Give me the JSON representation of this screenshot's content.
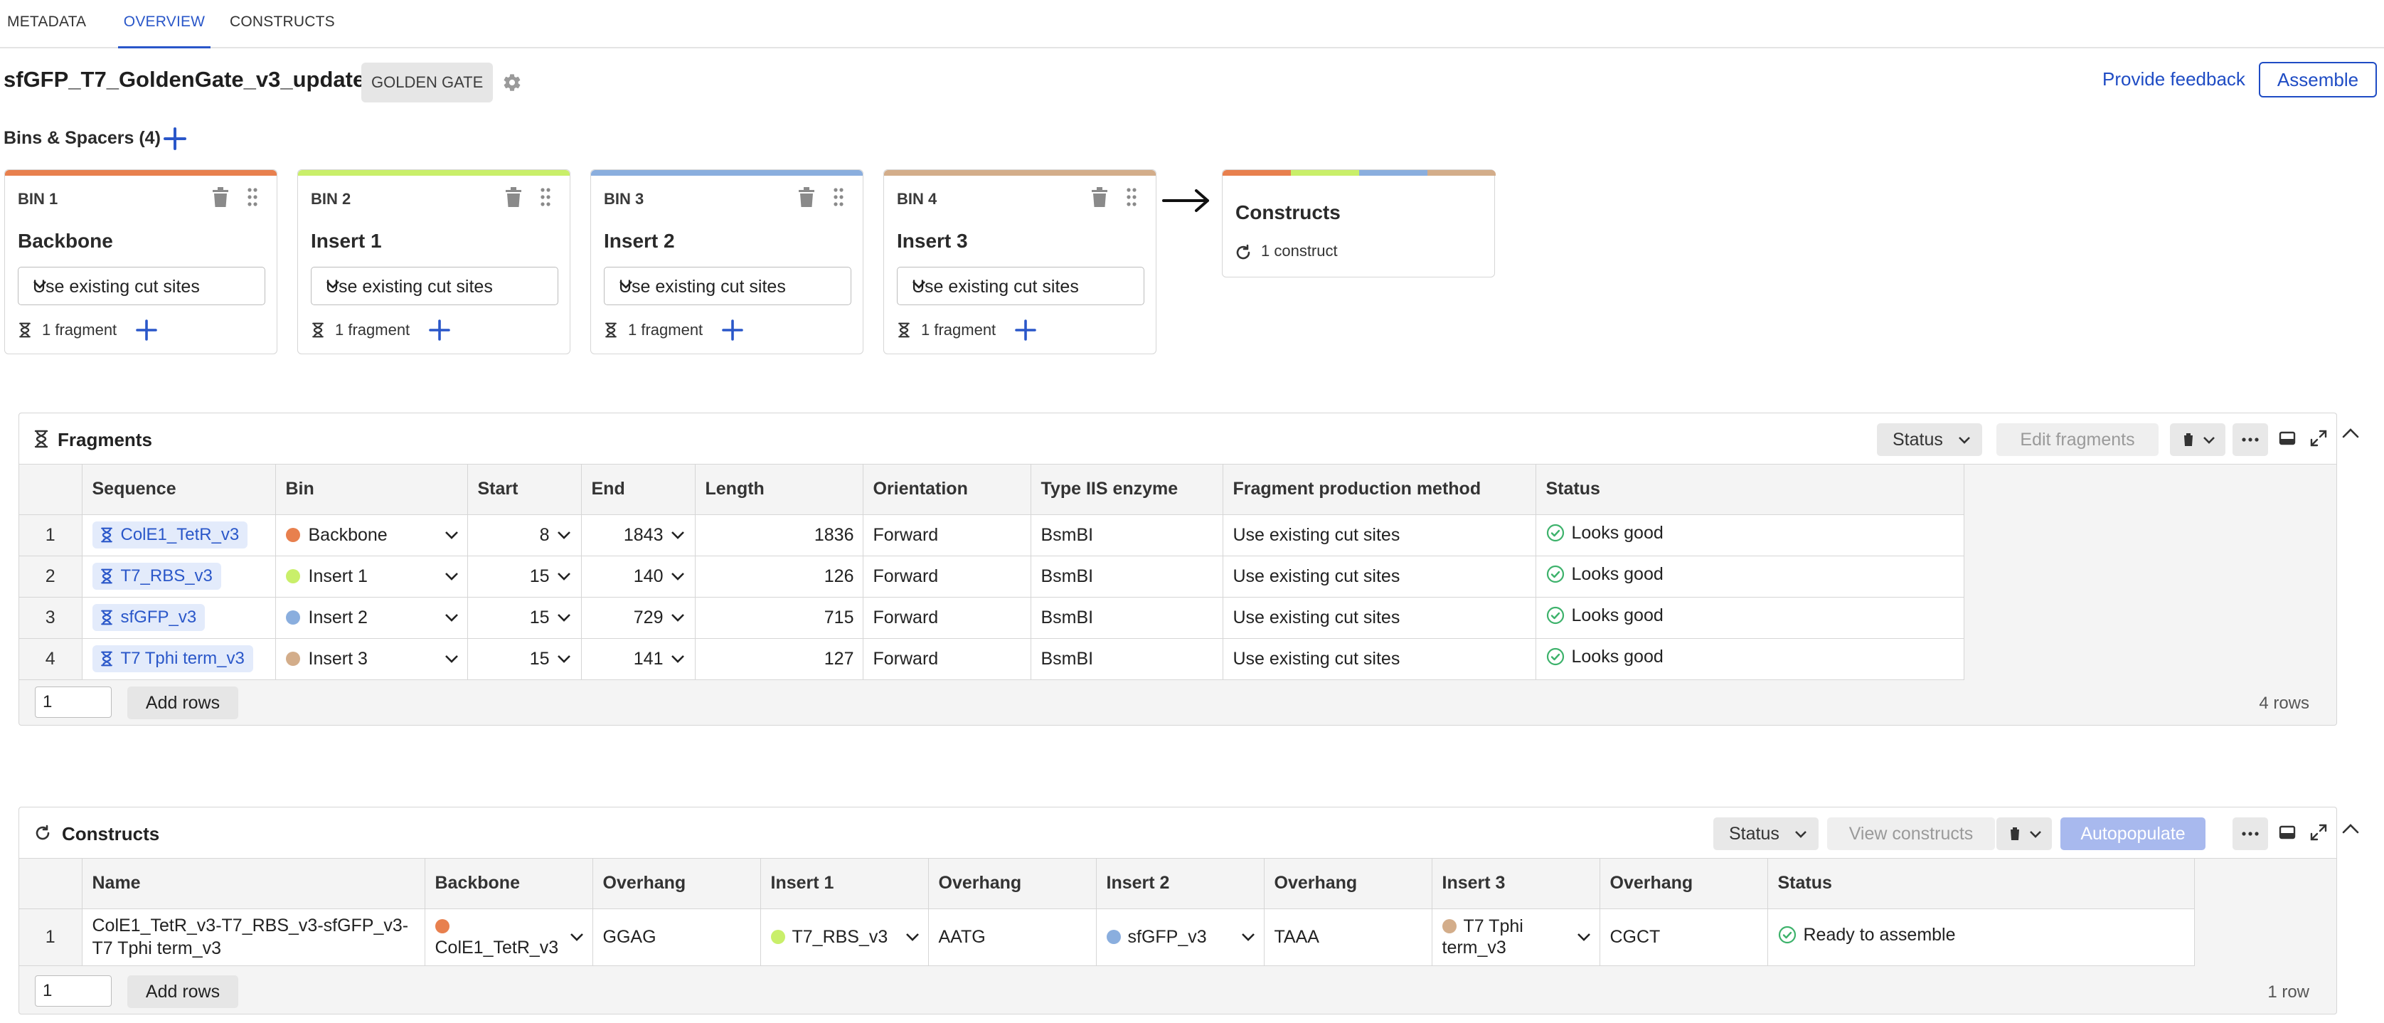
{
  "tabs": [
    {
      "label": "METADATA"
    },
    {
      "label": "OVERVIEW",
      "active": true
    },
    {
      "label": "CONSTRUCTS"
    }
  ],
  "header": {
    "title": "sfGFP_T7_GoldenGate_v3_updated",
    "badge": "GOLDEN GATE",
    "feedback_label": "Provide feedback",
    "assemble_label": "Assemble"
  },
  "bins_section": {
    "label": "Bins & Spacers (4)"
  },
  "colors": {
    "accent": "#2a57c9",
    "bin1": "#e8804e",
    "bin2": "#c9ef6a",
    "bin3": "#8aaede",
    "bin4": "#d3ad8a",
    "ok": "#3db26b"
  },
  "bins": [
    {
      "id": "BIN 1",
      "name": "Backbone",
      "method": "Use existing cut sites",
      "fragments": "1 fragment",
      "color": "#e8804e"
    },
    {
      "id": "BIN 2",
      "name": "Insert 1",
      "method": "Use existing cut sites",
      "fragments": "1 fragment",
      "color": "#c9ef6a"
    },
    {
      "id": "BIN 3",
      "name": "Insert 2",
      "method": "Use existing cut sites",
      "fragments": "1 fragment",
      "color": "#8aaede"
    },
    {
      "id": "BIN 4",
      "name": "Insert 3",
      "method": "Use existing cut sites",
      "fragments": "1 fragment",
      "color": "#d3ad8a"
    }
  ],
  "constructs_card": {
    "title": "Constructs",
    "count": "1 construct"
  },
  "fragments_panel": {
    "title": "Fragments",
    "status_btn": "Status",
    "edit_btn": "Edit fragments",
    "columns": [
      "",
      "Sequence",
      "Bin",
      "Start",
      "End",
      "Length",
      "Orientation",
      "Type IIS enzyme",
      "Fragment production method",
      "Status"
    ],
    "rows": [
      {
        "n": "1",
        "sequence": "ColE1_TetR_v3",
        "bin": "Backbone",
        "bin_color": "#e8804e",
        "start": "8",
        "end": "1843",
        "length": "1836",
        "orientation": "Forward",
        "enzyme": "BsmBI",
        "method": "Use existing cut sites",
        "status": "Looks good"
      },
      {
        "n": "2",
        "sequence": "T7_RBS_v3",
        "bin": "Insert 1",
        "bin_color": "#c9ef6a",
        "start": "15",
        "end": "140",
        "length": "126",
        "orientation": "Forward",
        "enzyme": "BsmBI",
        "method": "Use existing cut sites",
        "status": "Looks good"
      },
      {
        "n": "3",
        "sequence": "sfGFP_v3",
        "bin": "Insert 2",
        "bin_color": "#8aaede",
        "start": "15",
        "end": "729",
        "length": "715",
        "orientation": "Forward",
        "enzyme": "BsmBI",
        "method": "Use existing cut sites",
        "status": "Looks good"
      },
      {
        "n": "4",
        "sequence": "T7 Tphi term_v3",
        "bin": "Insert 3",
        "bin_color": "#d3ad8a",
        "start": "15",
        "end": "141",
        "length": "127",
        "orientation": "Forward",
        "enzyme": "BsmBI",
        "method": "Use existing cut sites",
        "status": "Looks good"
      }
    ],
    "rows_input": "1",
    "add_rows": "Add rows",
    "row_count": "4 rows"
  },
  "constructs_panel": {
    "title": "Constructs",
    "status_btn": "Status",
    "view_btn": "View constructs",
    "autopopulate_btn": "Autopopulate",
    "columns": [
      "",
      "Name",
      "Backbone",
      "Overhang",
      "Insert 1",
      "Overhang",
      "Insert 2",
      "Overhang",
      "Insert 3",
      "Overhang",
      "Status"
    ],
    "rows": [
      {
        "n": "1",
        "name": "ColE1_TetR_v3-T7_RBS_v3-sfGFP_v3-T7 Tphi term_v3",
        "backbone": "ColE1_TetR_v3",
        "oh1": "GGAG",
        "insert1": "T7_RBS_v3",
        "oh2": "AATG",
        "insert2": "sfGFP_v3",
        "oh3": "TAAA",
        "insert3": "T7 Tphi term_v3",
        "oh4": "CGCT",
        "status": "Ready to assemble"
      }
    ],
    "rows_input": "1",
    "add_rows": "Add rows",
    "row_count": "1 row"
  }
}
